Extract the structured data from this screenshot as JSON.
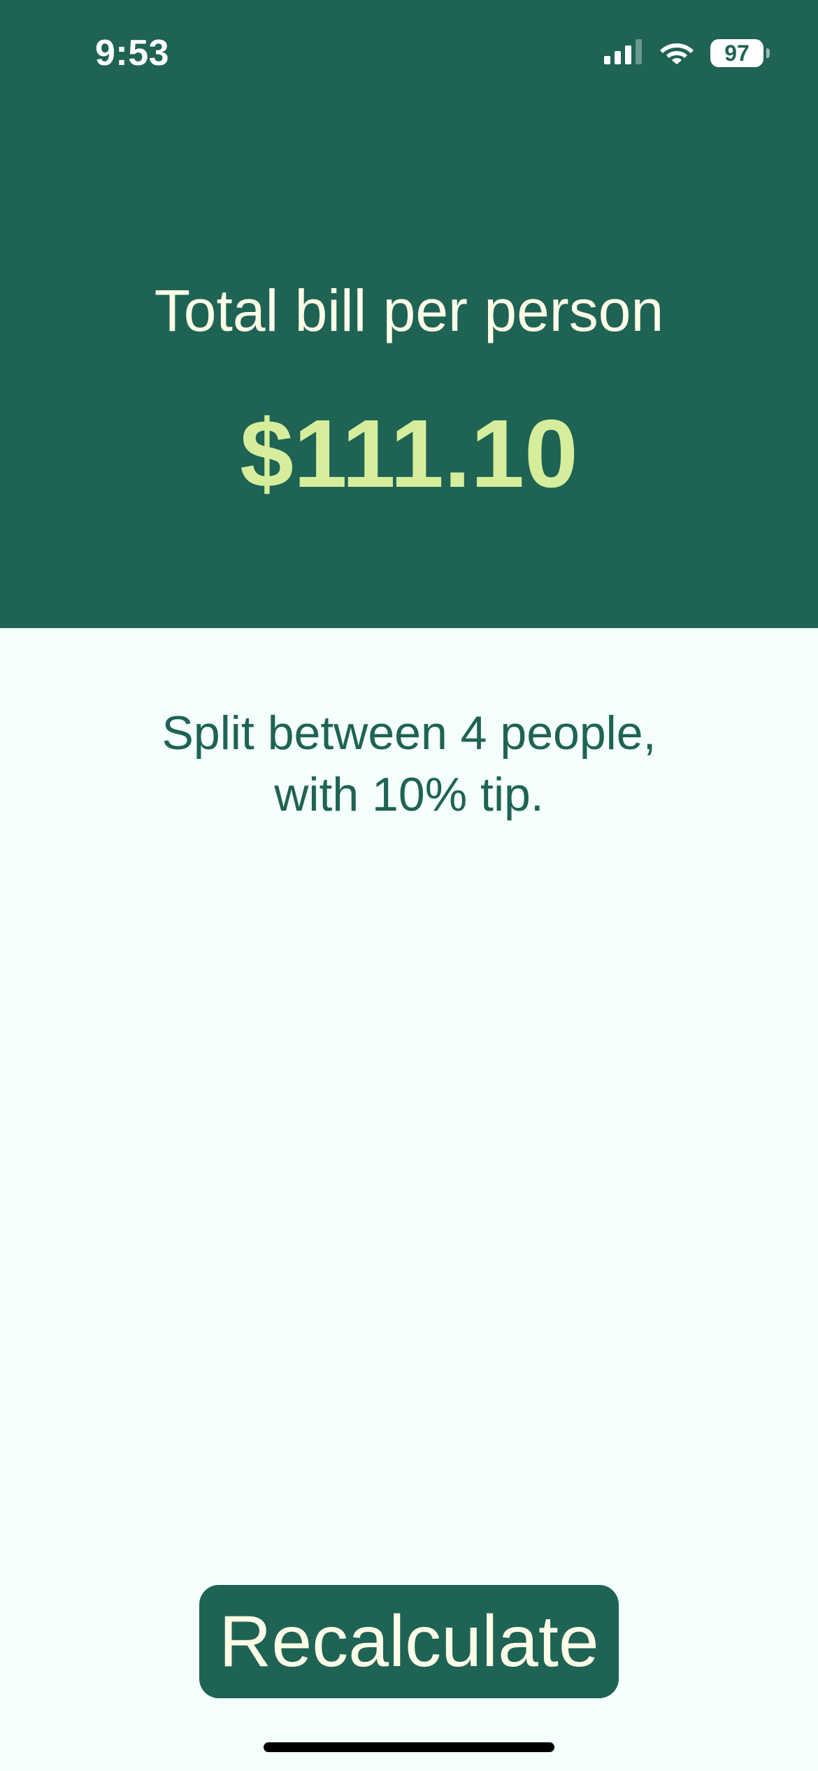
{
  "status_bar": {
    "time": "9:53",
    "battery_level": "97",
    "icons": [
      "cellular-signal-icon",
      "wifi-icon",
      "battery-icon"
    ]
  },
  "result": {
    "title": "Total bill per person",
    "amount": "$111.10"
  },
  "summary": {
    "line1": "Split between 4 people,",
    "line2": "with 10% tip."
  },
  "actions": {
    "recalculate_label": "Recalculate"
  },
  "colors": {
    "header_background": "#1E6354",
    "amount_text": "#D6EE9C",
    "title_text": "#FFFDE8",
    "page_background": "#F5FFFB",
    "button_background": "#1E6354"
  }
}
